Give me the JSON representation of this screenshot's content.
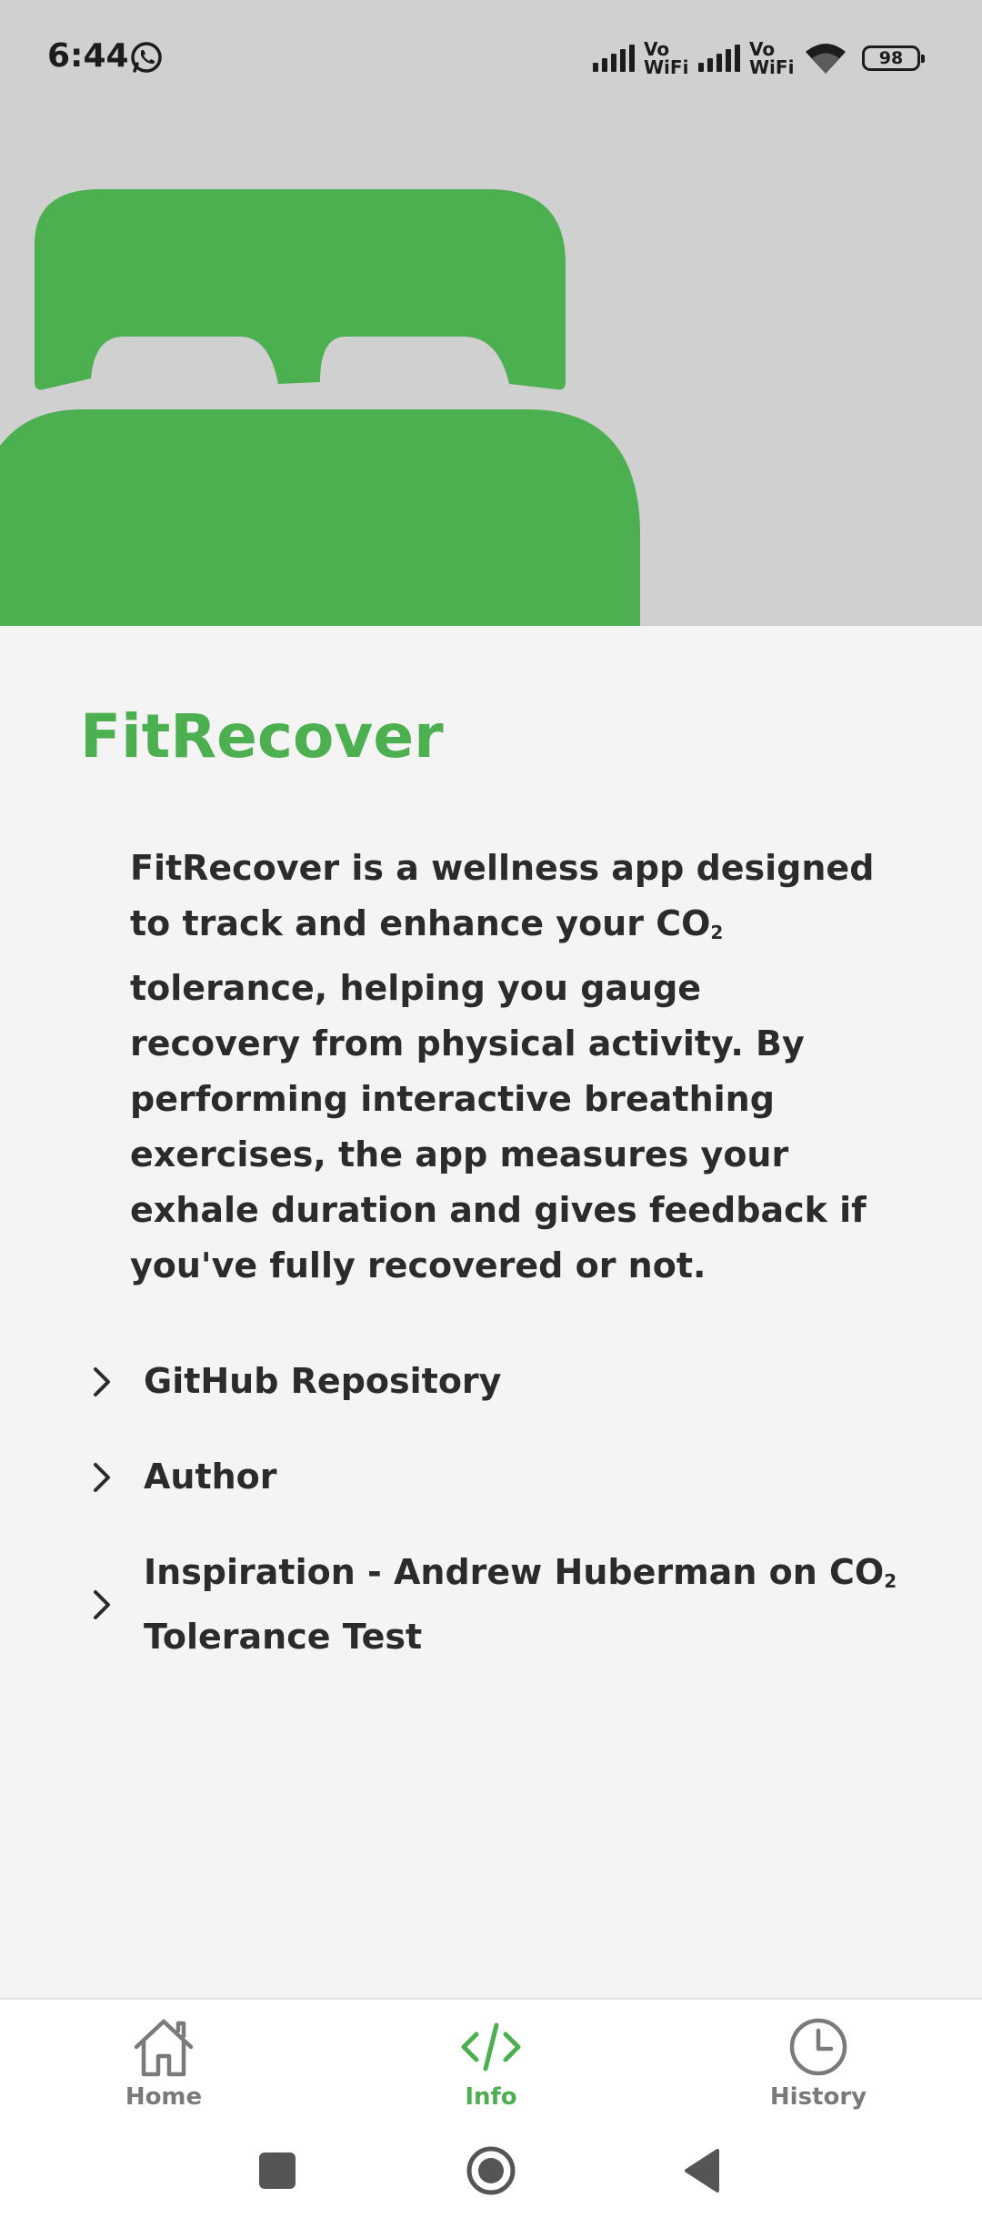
{
  "status_bar": {
    "time": "6:44",
    "network_label_1": "Vo WiFi",
    "network_label_2": "Vo WiFi",
    "battery_level": "98"
  },
  "app": {
    "title": "FitRecover",
    "description_before": "FitRecover is a wellness app designed to track and enhance your CO",
    "description_sub": "2",
    "description_after": " tolerance, helping you gauge recovery from physical activity. By performing interactive breathing exercises, the app measures your exhale duration and gives feedback if you've fully recovered or not."
  },
  "links": [
    {
      "label": "GitHub Repository"
    },
    {
      "label": "Author"
    },
    {
      "label_before": "Inspiration - Andrew Huberman on CO",
      "label_sub": "2",
      "label_after": " Tolerance Test"
    }
  ],
  "bottom_nav": {
    "items": [
      {
        "label": "Home",
        "icon": "home-icon",
        "active": false
      },
      {
        "label": "Info",
        "icon": "code-icon",
        "active": true
      },
      {
        "label": "History",
        "icon": "clock-icon",
        "active": false
      }
    ]
  },
  "colors": {
    "accent": "#4caf50",
    "header_bg": "#d0d0d0",
    "content_bg": "#f4f4f4",
    "text": "#2b2b2b",
    "inactive": "#7a7a7a"
  }
}
